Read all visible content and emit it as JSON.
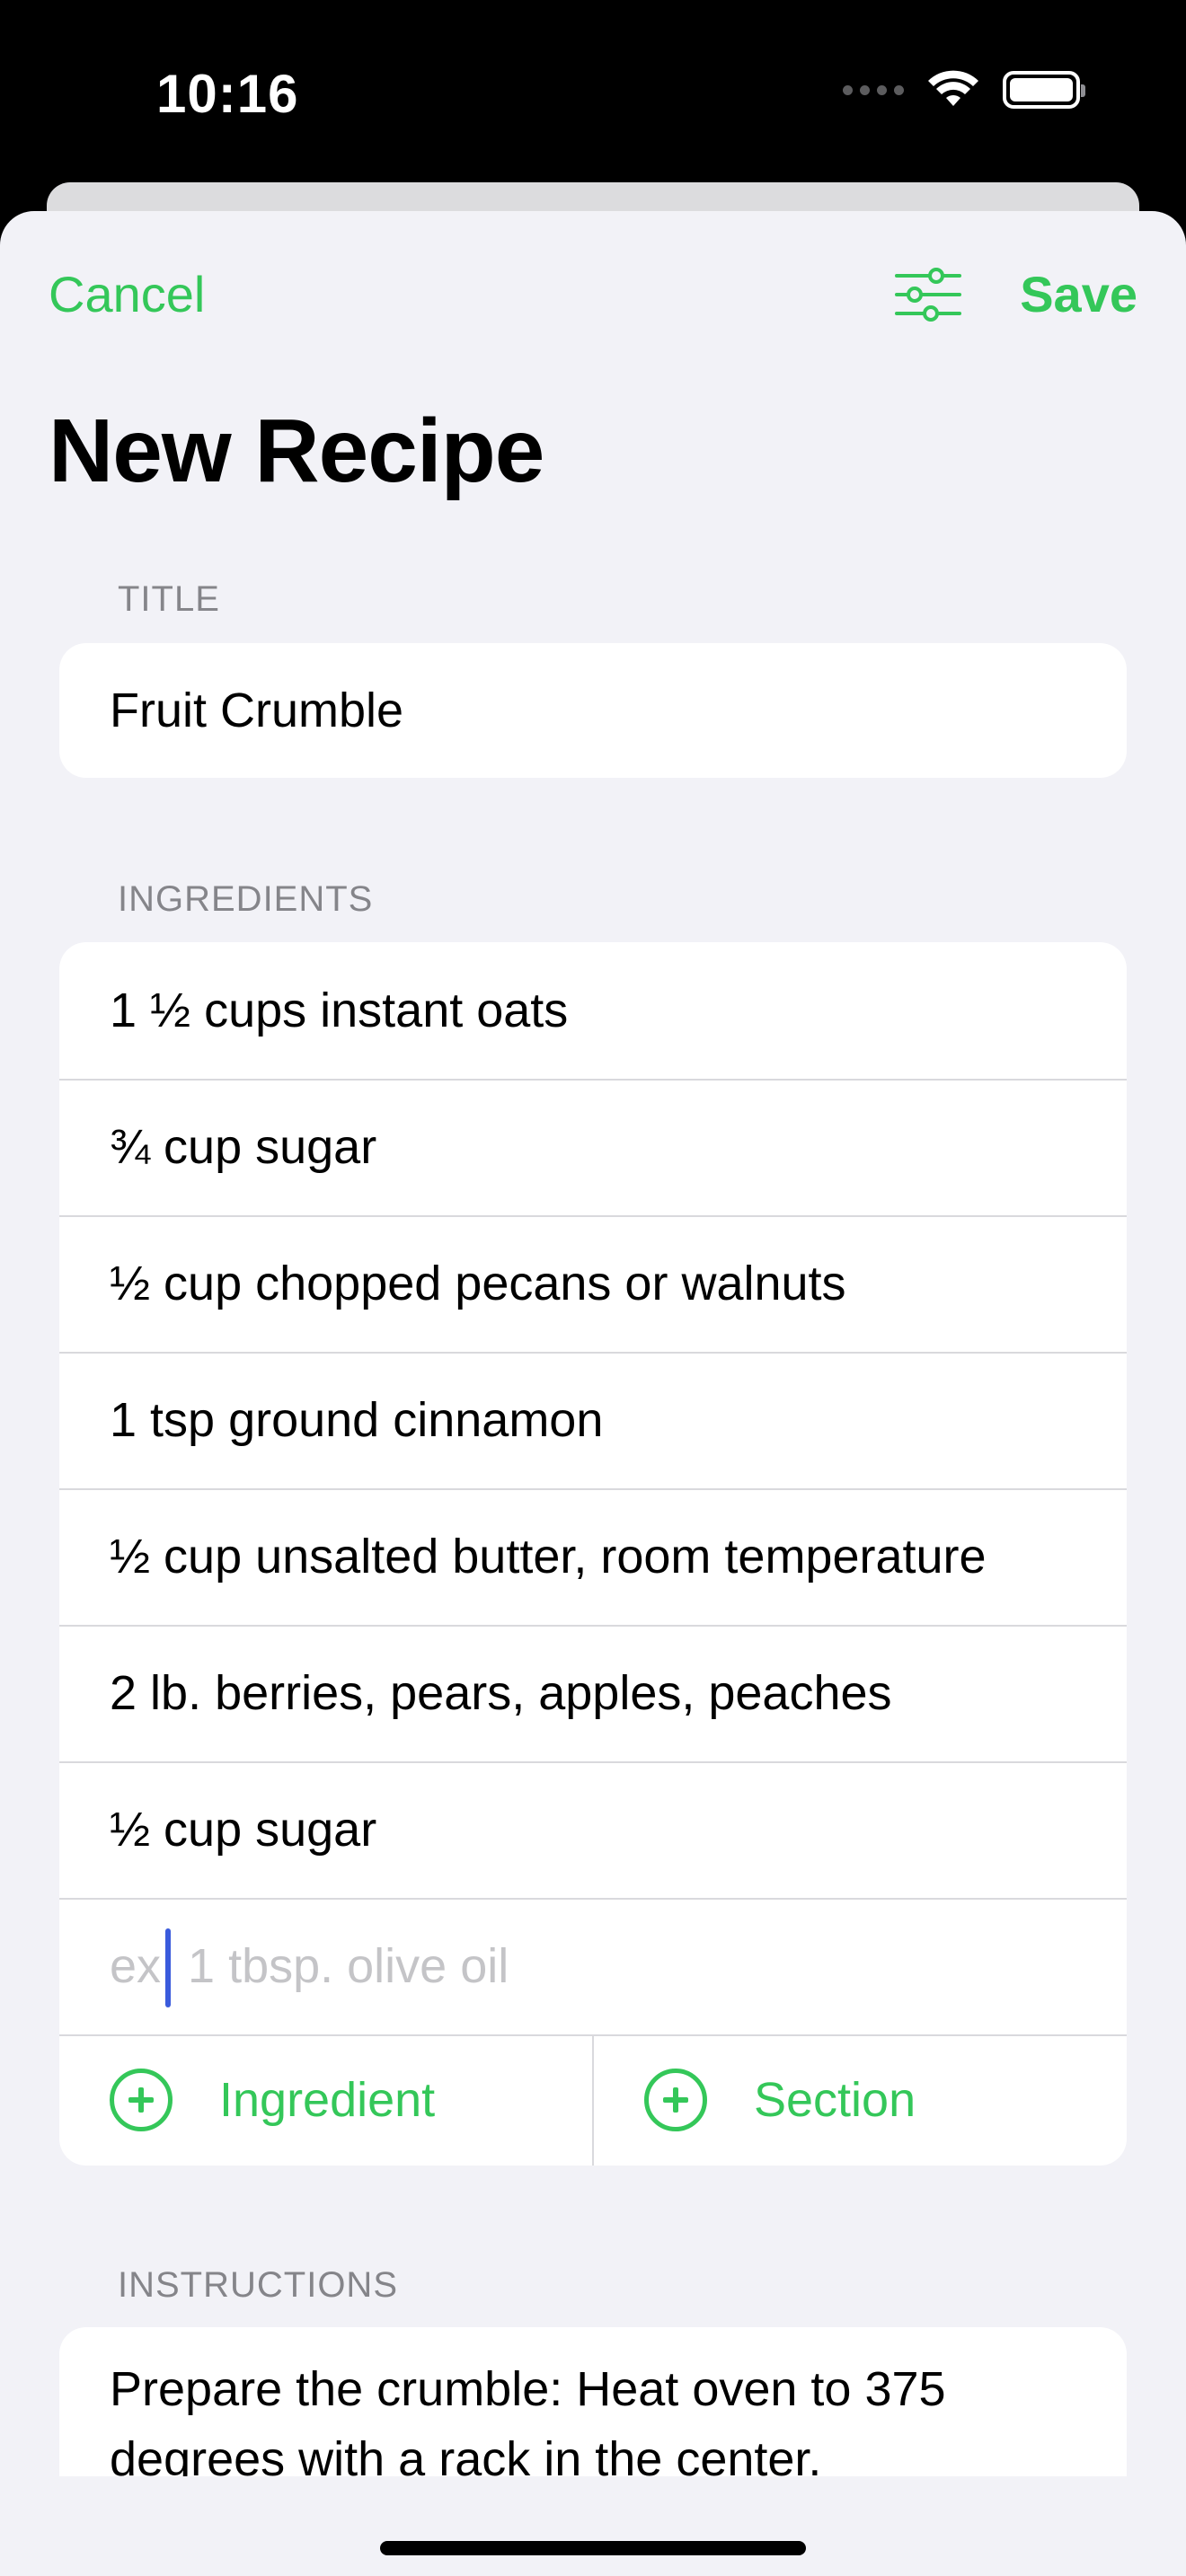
{
  "status_bar": {
    "time": "10:16",
    "icons": [
      "signal-dots-icon",
      "wifi-icon",
      "battery-icon"
    ]
  },
  "nav": {
    "cancel_label": "Cancel",
    "filter_icon": "sliders-icon",
    "save_label": "Save"
  },
  "page": {
    "title": "New Recipe"
  },
  "title_section": {
    "header": "TITLE",
    "value": "Fruit Crumble"
  },
  "ingredients_section": {
    "header": "INGREDIENTS",
    "items": [
      "1 ½ cups instant oats",
      "¾ cup sugar",
      "½ cup chopped pecans or walnuts",
      "1 tsp ground cinnamon",
      "½ cup unsalted butter, room temperature",
      "2 lb. berries, pears, apples, peaches",
      "½ cup sugar"
    ],
    "new_item_placeholder": "ex: 1 tbsp. olive oil",
    "add_ingredient_label": "Ingredient",
    "add_section_label": "Section"
  },
  "instructions_section": {
    "header": "INSTRUCTIONS",
    "text": "Prepare the crumble: Heat oven to 375 degrees with a rack in the center."
  },
  "colors": {
    "accent": "#34c759",
    "background": "#f2f2f7",
    "card": "#ffffff",
    "section_header": "#85858a",
    "placeholder": "#c4c4c7",
    "caret": "#3a5bdc"
  }
}
